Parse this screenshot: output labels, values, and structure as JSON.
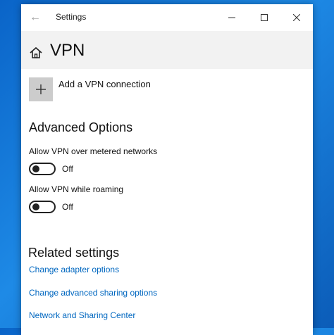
{
  "window": {
    "title": "Settings",
    "back_glyph": "←",
    "minimize_glyph": "—",
    "maximize_glyph": "☐",
    "close_glyph": "✕"
  },
  "page": {
    "title": "VPN",
    "icon": "home-icon"
  },
  "add_vpn": {
    "label": "Add a VPN connection",
    "icon": "plus-icon"
  },
  "advanced": {
    "heading": "Advanced Options",
    "options": [
      {
        "label": "Allow VPN over metered networks",
        "state": "Off",
        "on": false
      },
      {
        "label": "Allow VPN while roaming",
        "state": "Off",
        "on": false
      }
    ]
  },
  "related": {
    "heading": "Related settings",
    "links": [
      "Change adapter options",
      "Change advanced sharing options",
      "Network and Sharing Center"
    ]
  },
  "colors": {
    "accent_link": "#0067c0",
    "desktop": "#1e8ae6"
  }
}
